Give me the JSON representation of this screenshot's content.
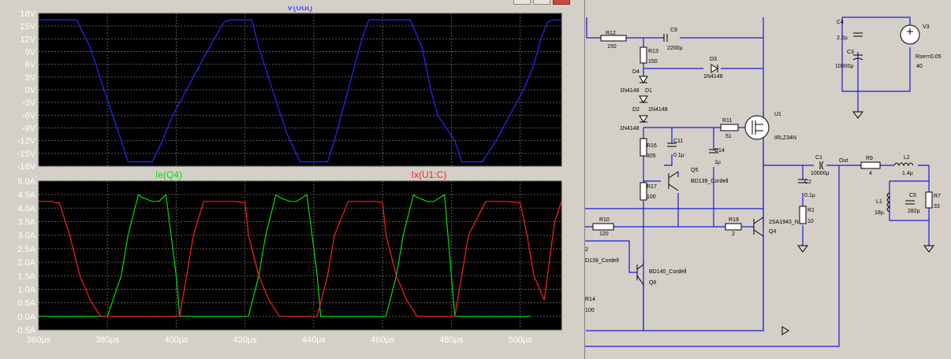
{
  "colors": {
    "background": "#000000",
    "grid": "#5a5a5a",
    "axis_text": "#ffffff",
    "v_out": "#2828ff",
    "ie_q4": "#00e000",
    "ix_u1": "#ff2020",
    "schematic_wire": "#1a1ad9",
    "schematic_bg": "#d4d0c8"
  },
  "chart_data": [
    {
      "type": "line",
      "title": "V(out)",
      "unit": "V",
      "xlim": [
        360,
        512
      ],
      "x_tick_labels": [
        "360µs",
        "380µs",
        "400µs",
        "420µs",
        "440µs",
        "460µs",
        "480µs",
        "500µs"
      ],
      "y_tick_labels": [
        "18V",
        "15V",
        "12V",
        "9V",
        "6V",
        "3V",
        "0V",
        "-3V",
        "-6V",
        "-9V",
        "-12V",
        "-15V",
        "-18V"
      ],
      "ylim": [
        -18,
        18
      ],
      "grid": true,
      "series": [
        {
          "name": "V(out)",
          "color": "#2828ff",
          "x": [
            360,
            363,
            367,
            371,
            375,
            379,
            381.5,
            384,
            386,
            391,
            393,
            396,
            399,
            403,
            407,
            411,
            414,
            416,
            418,
            420,
            422,
            424,
            428,
            432,
            436,
            440,
            444,
            446,
            448,
            450,
            452,
            454,
            456,
            460,
            464,
            468,
            471.5,
            474,
            476,
            481,
            483,
            486,
            489,
            493,
            497,
            501,
            504,
            506,
            508,
            510,
            512
          ],
          "y": [
            16.5,
            16.5,
            16.5,
            16.5,
            10,
            0,
            -6,
            -12,
            -17,
            -17,
            -17,
            -12,
            -6,
            0,
            6,
            12,
            16,
            16.5,
            16.5,
            16.5,
            16.5,
            10,
            0,
            -10,
            -17,
            -17,
            -17,
            -12,
            -6,
            0,
            6,
            12,
            16.5,
            16.5,
            16.5,
            16.5,
            10,
            0,
            -6,
            -12,
            -17,
            -17,
            -17,
            -12,
            -6,
            0,
            6,
            12,
            16,
            16.5,
            16.5
          ]
        }
      ]
    },
    {
      "type": "line",
      "title": "",
      "unit": "A",
      "xlim": [
        360,
        512
      ],
      "x_tick_labels": [
        "360µs",
        "380µs",
        "400µs",
        "420µs",
        "440µs",
        "460µs",
        "480µs",
        "500µs"
      ],
      "y_tick_labels": [
        "5.0A",
        "4.5A",
        "4.0A",
        "3.5A",
        "3.0A",
        "2.5A",
        "2.0A",
        "1.5A",
        "1.0A",
        "0.5A",
        "0.0A",
        "-0.5A"
      ],
      "ylim": [
        -0.5,
        5.0
      ],
      "grid": true,
      "series": [
        {
          "name": "Ie(Q4)",
          "color": "#00e000",
          "x": [
            360,
            378,
            380,
            384,
            386,
            389,
            390,
            393,
            395,
            397,
            400,
            401,
            403,
            418,
            421,
            424,
            426,
            429,
            430,
            433,
            435,
            438,
            441,
            442,
            443,
            458,
            461,
            464,
            466,
            469,
            470,
            473,
            475,
            478,
            480,
            481,
            482,
            500,
            503
          ],
          "y": [
            0,
            0,
            0,
            1.5,
            3.0,
            4.5,
            4.4,
            4.25,
            4.25,
            4.5,
            1.5,
            0,
            0,
            0,
            0,
            1.5,
            3.0,
            4.5,
            4.4,
            4.25,
            4.25,
            4.5,
            1.5,
            0,
            0,
            0,
            0,
            1.5,
            3.0,
            4.5,
            4.4,
            4.25,
            4.25,
            4.5,
            1.5,
            0,
            0,
            0,
            0
          ]
        },
        {
          "name": "Ix(U1:C)",
          "color": "#ff2020",
          "x": [
            360,
            364,
            365,
            366,
            369,
            372,
            375,
            378,
            380,
            398,
            401,
            403,
            405,
            408,
            412,
            417,
            420,
            421,
            424,
            427,
            430,
            438,
            441,
            444,
            446,
            450,
            454,
            458,
            460,
            461,
            464,
            467,
            470,
            478,
            481,
            483,
            485,
            490,
            496,
            500,
            502,
            504,
            507,
            510,
            512
          ],
          "y": [
            4.25,
            4.25,
            4.2,
            4.2,
            3.0,
            1.5,
            0.6,
            0,
            0,
            0,
            0,
            1.5,
            3.0,
            4.25,
            4.25,
            4.25,
            4.2,
            3.0,
            1.5,
            0.6,
            0,
            0,
            0,
            1.5,
            3.0,
            4.25,
            4.25,
            4.25,
            4.2,
            3.0,
            1.5,
            0.6,
            0,
            0,
            0,
            1.5,
            3.0,
            4.25,
            4.25,
            4.2,
            3.0,
            1.5,
            0.6,
            3.5,
            4.25
          ]
        }
      ]
    }
  ],
  "schematic": {
    "labels": {
      "r12": "R12",
      "r12_val": "150",
      "c9": "C9",
      "c9_val": "2200µ",
      "r13": "R13",
      "r13_val": "150",
      "d3": "D3",
      "d3_val": "1N4148",
      "d4": "D4",
      "d4_val": "1N4148",
      "d1": "D1",
      "d2": "D2",
      "d2_val": "1N4148",
      "d_val3": "1N4148",
      "r11": "R11",
      "r11_val": "51",
      "u1": "U1",
      "u1_val": "IRLZ34N",
      "c4": "C4",
      "c4_val": "2.2µ",
      "c3": "C3",
      "c3_val": "10000µ",
      "v3": "V3",
      "rser": "Rser=0.05",
      "v3_val": "40",
      "r16": "R16",
      "r16_val": "305",
      "c11": "C11",
      "c11_val": "0.1µ",
      "c14": "C14",
      "c14_val": "1µ",
      "q5": "Q5",
      "q5_val": "BD139_Cordell",
      "r17": "R17",
      "r17_val": "100",
      "c1": "C1",
      "c1_val": "10000µ",
      "out": "Out",
      "r9": "R9",
      "r9_val": "4",
      "l2": "L2",
      "l2_val": "1.4µ",
      "c2": "C2",
      "c2_val": "0.1µ",
      "r1": "R1",
      "r1_val": "10",
      "l1": "L1",
      "l1_val": "18µ",
      "c5": "C5",
      "c5_val": "282µ",
      "r7": "R7",
      "r7_val": "33",
      "r10": "R10",
      "r10_val": "120",
      "r18": "R18",
      "r18_val": "2",
      "q4_val": "2SA1943_N",
      "q4": "Q4",
      "q6_partial_a": "2",
      "q6_partial_b": "D139_Cordell",
      "q6_val": "BD140_Cordell",
      "q6": "Q6",
      "r14": "R14",
      "r14_val": "100"
    }
  }
}
